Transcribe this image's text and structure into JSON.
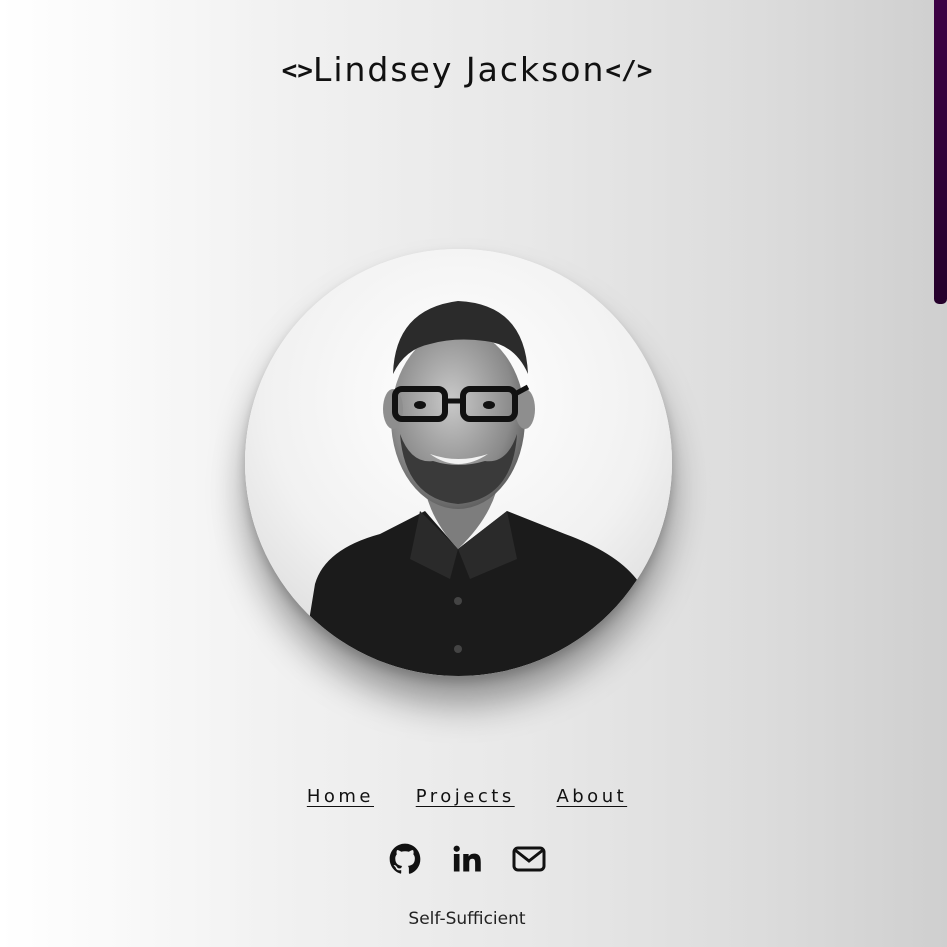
{
  "header": {
    "open_tag": "<>",
    "name": "Lindsey Jackson",
    "close_tag": "</>"
  },
  "nav": {
    "items": [
      "Home",
      "Projects",
      "About"
    ]
  },
  "social": {
    "icons": [
      "github-icon",
      "linkedin-icon",
      "mail-icon"
    ]
  },
  "footer": {
    "tagline": "Self-Sufficient"
  },
  "colors": {
    "scrollbar_thumb": "#3d0044",
    "text": "#111111"
  }
}
